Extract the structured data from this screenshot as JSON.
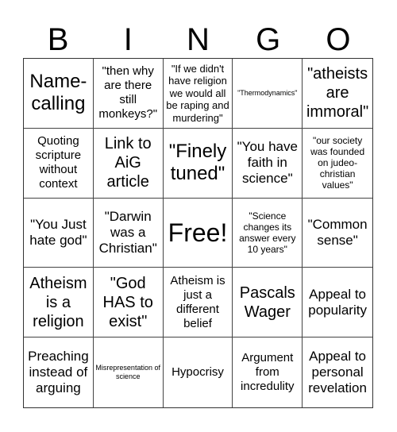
{
  "header": {
    "letters": [
      "B",
      "I",
      "N",
      "G",
      "O"
    ]
  },
  "cells": [
    "Name-calling",
    "\"then why are there still monkeys?\"",
    "\"If we didn't have religion we would all be raping and murdering\"",
    "\"Thermodynamics\"",
    "\"atheists are immoral\"",
    "Quoting scripture without context",
    "Link to AiG article",
    "\"Finely tuned\"",
    "\"You have faith in science\"",
    "\"our society was founded on judeo-christian values\"",
    "\"You Just hate god\"",
    "\"Darwin was a Christian\"",
    "Free!",
    "\"Science changes its answer every 10 years\"",
    "\"Common sense\"",
    "Atheism is a religion",
    "\"God HAS to exist\"",
    "Atheism is just a different belief",
    "Pascals Wager",
    "Appeal to popularity",
    "Preaching instead of arguing",
    "Misrepresentation of science",
    "Hypocrisy",
    "Argument from incredulity",
    "Appeal to personal revelation"
  ]
}
